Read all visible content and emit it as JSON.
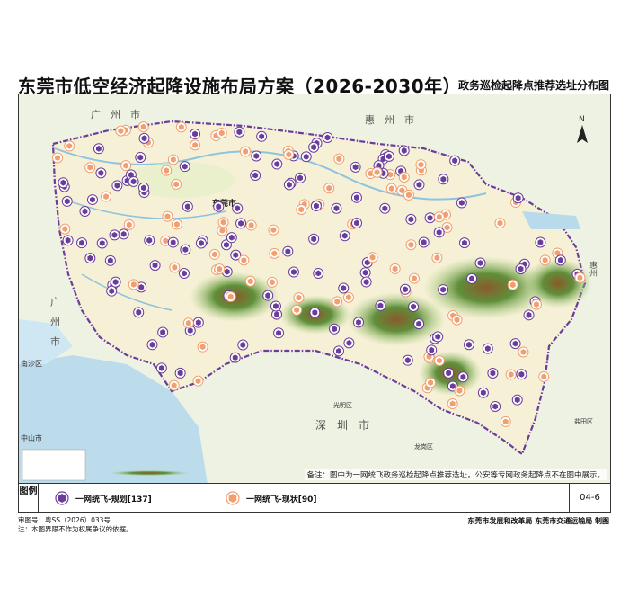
{
  "header": {
    "title": "东莞市低空经济起降设施布局方案（2026-2030年）",
    "subtitle": "政务巡检起降点推荐选址分布图"
  },
  "map": {
    "region_labels": {
      "guangzhou_top": "广　州　市",
      "huizhou": "惠　州　市",
      "guangzhou_left": "广　州　市",
      "nansha": "南沙区",
      "zhongshan": "中山市",
      "shenzhen": "深　圳　市",
      "guangming": "光明区",
      "longgang": "龙岗区",
      "yantian": "盐田区",
      "huizhou_right": "惠州"
    },
    "city_label": "东莞市",
    "north_label": "N",
    "note": "备注：图中为一网统飞政务巡检起降点推荐选址，公安等专网政务起降点不在图中展示。",
    "colors": {
      "planned": "#6a3d9a",
      "existing": "#f0a070",
      "water": "#cfe7f2",
      "land": "#f6f1d6"
    }
  },
  "legend": {
    "title": "图例",
    "planned_label": "一网统飞-规划[137]",
    "existing_label": "一网统飞-现状[90]",
    "page_no": "04-6"
  },
  "footer": {
    "approval": "审图号：粤SS（2026）033号",
    "disclaimer": "注：本图界限不作为权属争议的依据。",
    "makers": "东莞市发展和改革局  东莞市交通运输局  制图"
  }
}
